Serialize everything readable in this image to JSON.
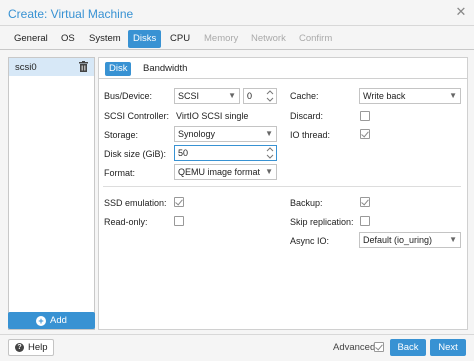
{
  "window": {
    "title": "Create: Virtual Machine"
  },
  "tabs": [
    {
      "label": "General",
      "state": "normal"
    },
    {
      "label": "OS",
      "state": "normal"
    },
    {
      "label": "System",
      "state": "normal"
    },
    {
      "label": "Disks",
      "state": "active"
    },
    {
      "label": "CPU",
      "state": "normal"
    },
    {
      "label": "Memory",
      "state": "disabled"
    },
    {
      "label": "Network",
      "state": "disabled"
    },
    {
      "label": "Confirm",
      "state": "disabled"
    }
  ],
  "disks": {
    "items": [
      {
        "name": "scsi0"
      }
    ],
    "add_label": "Add"
  },
  "subtabs": [
    {
      "label": "Disk",
      "active": true
    },
    {
      "label": "Bandwidth",
      "active": false
    }
  ],
  "form": {
    "bus_device": {
      "label": "Bus/Device:",
      "bus": "SCSI",
      "device": "0"
    },
    "scsi_controller": {
      "label": "SCSI Controller:",
      "value": "VirtIO SCSI single"
    },
    "storage": {
      "label": "Storage:",
      "value": "Synology"
    },
    "disk_size": {
      "label": "Disk size (GiB):",
      "value": "50"
    },
    "format": {
      "label": "Format:",
      "value": "QEMU image format"
    },
    "cache": {
      "label": "Cache:",
      "value": "Write back"
    },
    "discard": {
      "label": "Discard:",
      "checked": false
    },
    "io_thread": {
      "label": "IO thread:",
      "checked": true
    },
    "ssd_emulation": {
      "label": "SSD emulation:",
      "checked": true
    },
    "read_only": {
      "label": "Read-only:",
      "checked": false
    },
    "backup": {
      "label": "Backup:",
      "checked": true
    },
    "skip_replication": {
      "label": "Skip replication:",
      "checked": false
    },
    "async_io": {
      "label": "Async IO:",
      "value": "Default (io_uring)"
    }
  },
  "footer": {
    "help_label": "Help",
    "advanced_label": "Advanced",
    "advanced_checked": true,
    "back_label": "Back",
    "next_label": "Next"
  },
  "colors": {
    "accent": "#3892d3",
    "selected_row": "#d7e8f7"
  },
  "icons": [
    "close-icon",
    "trash-icon",
    "plus-icon",
    "help-icon",
    "chevron-down-icon",
    "spinner-icon",
    "checkbox-icon"
  ]
}
